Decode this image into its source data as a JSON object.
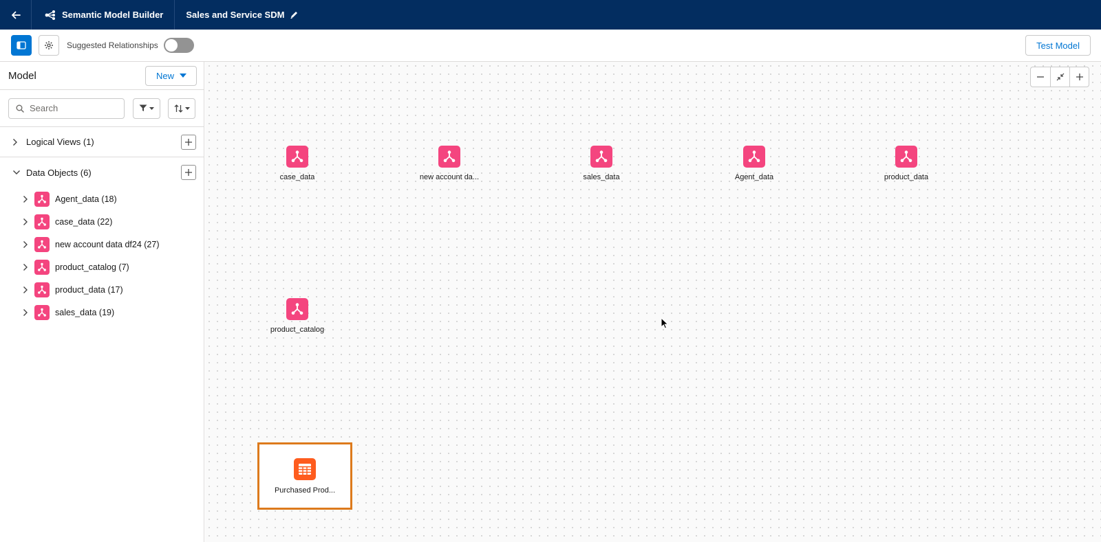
{
  "header": {
    "app_title": "Semantic Model Builder",
    "model_title": "Sales and Service SDM"
  },
  "toolbar": {
    "suggested_relationships_label": "Suggested Relationships",
    "suggested_relationships_on": false,
    "test_model_label": "Test Model"
  },
  "sidebar": {
    "title": "Model",
    "new_label": "New",
    "search_placeholder": "Search",
    "logical_views_label": "Logical Views (1)",
    "data_objects_label": "Data Objects (6)",
    "data_objects": [
      {
        "label": "Agent_data (18)"
      },
      {
        "label": "case_data (22)"
      },
      {
        "label": "new account data df24 (27)"
      },
      {
        "label": "product_catalog (7)"
      },
      {
        "label": "product_data (17)"
      },
      {
        "label": "sales_data (19)"
      }
    ]
  },
  "canvas": {
    "nodes": [
      {
        "label": "case_data"
      },
      {
        "label": "new account da..."
      },
      {
        "label": "sales_data"
      },
      {
        "label": "Agent_data"
      },
      {
        "label": "product_data"
      },
      {
        "label": "product_catalog"
      }
    ],
    "selected_node": {
      "label": "Purchased Prod..."
    }
  },
  "colors": {
    "header_bg": "#032d60",
    "brand_blue": "#0176d3",
    "data_object_pink": "#f4457f",
    "table_orange": "#fe5c1e",
    "selection_border": "#dd7a1c"
  }
}
